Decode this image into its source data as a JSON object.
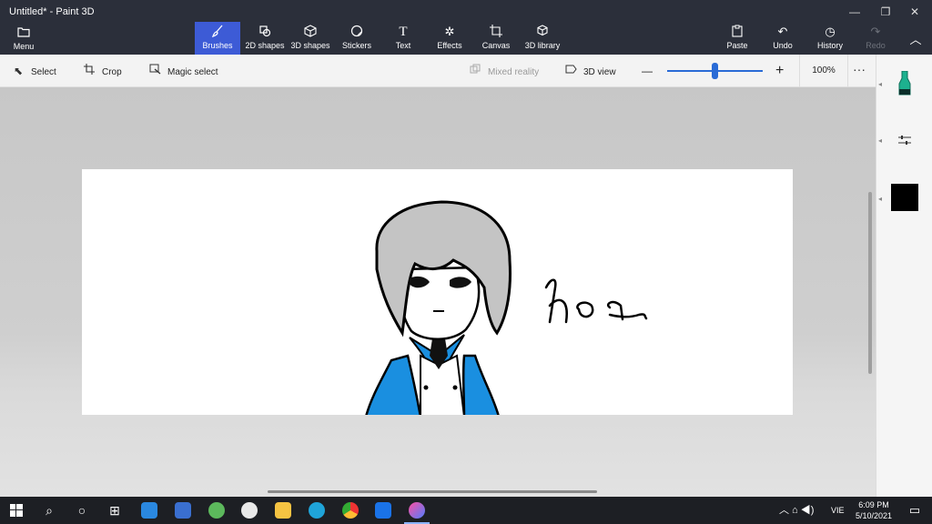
{
  "window": {
    "title": "Untitled* - Paint 3D",
    "minimize_glyph": "—",
    "maximize_glyph": "❐",
    "close_glyph": "✕"
  },
  "menu": {
    "label": "Menu",
    "icon": "folder-icon"
  },
  "toolbar": {
    "tools": [
      {
        "label": "Brushes",
        "icon": "brush-icon",
        "active": true
      },
      {
        "label": "2D shapes",
        "icon": "2d-shapes-icon"
      },
      {
        "label": "3D shapes",
        "icon": "3d-shapes-icon"
      },
      {
        "label": "Stickers",
        "icon": "stickers-icon"
      },
      {
        "label": "Text",
        "icon": "text-icon"
      },
      {
        "label": "Effects",
        "icon": "effects-icon"
      },
      {
        "label": "Canvas",
        "icon": "canvas-icon"
      },
      {
        "label": "3D library",
        "icon": "3d-library-icon"
      }
    ],
    "actions": [
      {
        "label": "Paste",
        "icon": "paste-icon"
      },
      {
        "label": "Undo",
        "icon": "undo-icon"
      },
      {
        "label": "History",
        "icon": "history-icon"
      },
      {
        "label": "Redo",
        "icon": "redo-icon",
        "disabled": true
      }
    ],
    "collapse_glyph": "︿"
  },
  "commandbar": {
    "select": "Select",
    "crop": "Crop",
    "magic_select": "Magic select",
    "mixed_reality": "Mixed reality",
    "view_3d": "3D view",
    "zoom_out": "—",
    "zoom_in": "+",
    "zoom_level": "100%",
    "more": "···",
    "zoom_fraction": 0.5
  },
  "canvas": {
    "handwriting": "hoa",
    "colors": {
      "hair": "#c4c4c4",
      "coat": "#1a8fe0",
      "ink": "#000000"
    }
  },
  "rightpanel": {
    "marker_color": "#1db18f",
    "selected_color": "#000000"
  },
  "taskbar": {
    "language": "VIE",
    "time": "6:09 PM",
    "date": "5/10/2021"
  }
}
